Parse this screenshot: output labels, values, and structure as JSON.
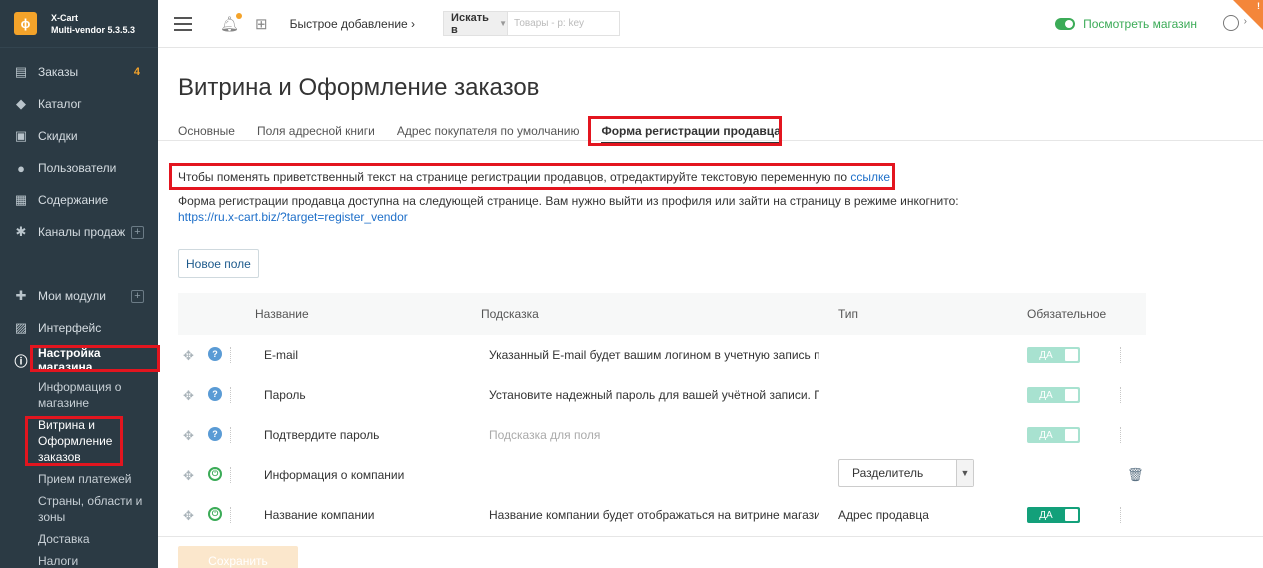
{
  "brand": {
    "logo_glyph": "ɸ",
    "line1": "X-Cart",
    "line2": "Multi-vendor 5.3.5.3"
  },
  "sidebar": {
    "items": [
      {
        "label": "Заказы",
        "icon": "orders-icon",
        "badge": "4"
      },
      {
        "label": "Каталог",
        "icon": "tag-icon"
      },
      {
        "label": "Скидки",
        "icon": "gift-icon"
      },
      {
        "label": "Пользователи",
        "icon": "users-icon"
      },
      {
        "label": "Содержание",
        "icon": "content-icon"
      },
      {
        "label": "Каналы продаж",
        "icon": "channels-icon",
        "plus": "+"
      },
      {
        "label": "Мои модули",
        "icon": "puzzle-icon",
        "plus": "+"
      },
      {
        "label": "Интерфейс",
        "icon": "image-icon"
      },
      {
        "label": "Настройка магазина",
        "icon": "info-icon"
      }
    ],
    "sub_items": [
      "Информация о магазине",
      "Витрина и Оформление заказов",
      "Прием платежей",
      "Страны, области и зоны",
      "Доставка",
      "Налоги"
    ]
  },
  "header": {
    "quick_add": "Быстрое добавление",
    "search_scope": "Искать в",
    "search_placeholder": "Товары - p: key",
    "view_store": "Посмотреть магазин",
    "corner_badge": "!"
  },
  "page": {
    "title": "Витрина и Оформление заказов",
    "tabs": [
      "Основные",
      "Поля адресной книги",
      "Адрес покупателя по умолчанию",
      "Форма регистрации продавца"
    ],
    "notice_text": "Чтобы поменять приветственный текст на странице регистрации продавцов, отредактируйте текстовую переменную по ",
    "notice_link": "ссылке",
    "info_text": "Форма регистрации продавца доступна на следующей странице. Вам нужно выйти из профиля или зайти на страницу в режиме инкогнито:",
    "info_link": "https://ru.x-cart.biz/?target=register_vendor",
    "new_field_button": "Новое поле",
    "save_button": "Сохранить"
  },
  "table": {
    "headers": {
      "name": "Название",
      "hint": "Подсказка",
      "type": "Тип",
      "required": "Обязательное"
    },
    "rows": [
      {
        "name": "E-mail",
        "hint": "Указанный E-mail будет вашим логином в учетную запись п",
        "type": "",
        "required": "ДА"
      },
      {
        "name": "Пароль",
        "hint": "Установите надежный пароль для вашей учётной записи. П",
        "type": "",
        "required": "ДА"
      },
      {
        "name": "Подтвердите пароль",
        "hint": "Подсказка для поля",
        "type": "",
        "required": "ДА"
      },
      {
        "name": "Информация о компании",
        "hint": "",
        "type": "Разделитель",
        "required": ""
      },
      {
        "name": "Название компании",
        "hint": "Название компании будет отображаться на витрине магазин",
        "type": "Адрес продавца",
        "required": "ДА"
      }
    ]
  },
  "colors": {
    "sidebar_bg": "#2b3a44",
    "accent": "#f4a32a",
    "green": "#3bab57",
    "toggle_on": "#13a07a",
    "highlight": "#e3151f"
  }
}
